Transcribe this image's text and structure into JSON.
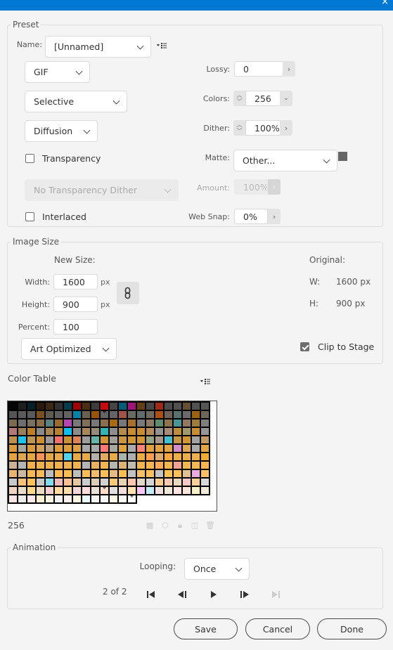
{
  "window": {
    "close_glyph": "×"
  },
  "preset": {
    "legend": "Preset",
    "name_label": "Name:",
    "name_value": "[Unnamed]",
    "format": "GIF",
    "palette": "Selective",
    "dither_method": "Diffusion",
    "transparency_label": "Transparency",
    "transparency_checked": false,
    "transparency_dither": "No Transparency Dither",
    "interlaced_label": "Interlaced",
    "interlaced_checked": false,
    "lossy_label": "Lossy:",
    "lossy_value": "0",
    "colors_label": "Colors:",
    "colors_value": "256",
    "dither_label": "Dither:",
    "dither_value": "100%",
    "matte_label": "Matte:",
    "matte_value": "Other...",
    "matte_color": "#666666",
    "amount_label": "Amount:",
    "amount_value": "100%",
    "websnap_label": "Web Snap:",
    "websnap_value": "0%"
  },
  "image_size": {
    "legend": "Image Size",
    "new_size_label": "New Size:",
    "width_label": "Width:",
    "width_value": "1600",
    "height_label": "Height:",
    "height_value": "900",
    "percent_label": "Percent:",
    "percent_value": "100",
    "unit": "px",
    "resample": "Art Optimized",
    "original_label": "Original:",
    "orig_w_label": "W:",
    "orig_w_value": "1600 px",
    "orig_h_label": "H:",
    "orig_h_value": "900 px",
    "clip_label": "Clip to Stage",
    "clip_checked": true
  },
  "color_table": {
    "title": "Color Table",
    "count": "256",
    "columns": 22,
    "selected_indices": [
      32,
      230,
      255
    ],
    "colors": [
      "#050505",
      "#1e1e1e",
      "#052028",
      "#2a1a0e",
      "#3c2814",
      "#303030",
      "#053c4a",
      "#a00505",
      "#4a2e14",
      "#3c3c3c",
      "#c80a0f",
      "#444444",
      "#055a78",
      "#a0147a",
      "#644019",
      "#464646",
      "#a02818",
      "#4a4a4a",
      "#505050",
      "#644e34",
      "#505050",
      "#555555",
      "#555555",
      "#5a5a5a",
      "#5a5a5a",
      "#7a5020",
      "#5e5a52",
      "#5e5e5e",
      "#626262",
      "#0a82a5",
      "#6a6050",
      "#965505",
      "#646464",
      "#646464",
      "#a05448",
      "#6a6a64",
      "#606c6a",
      "#6e6a60",
      "#aa5014",
      "#6e6258",
      "#5a706c",
      "#6a6a6a",
      "#9e620f",
      "#6e6658",
      "#7e6a50",
      "#6e6e6e",
      "#7a7060",
      "#8a6e48",
      "#5a8280",
      "#966a30",
      "#b446b4",
      "#787878",
      "#826e58",
      "#787878",
      "#8a6e50",
      "#aa6a14",
      "#787878",
      "#a87028",
      "#7a7a7a",
      "#8a7a64",
      "#5e8a6e",
      "#8e744c",
      "#489696",
      "#907862",
      "#a07c3a",
      "#808080",
      "#b47878",
      "#9a7e58",
      "#be7e28",
      "#8a8a8a",
      "#a88652",
      "#b48232",
      "#0abef0",
      "#8c8c8c",
      "#a8865a",
      "#968a78",
      "#32b4b4",
      "#8e8e8e",
      "#b48c50",
      "#c88c32",
      "#c88c32",
      "#b48c5a",
      "#929290",
      "#a88c78",
      "#be8c3c",
      "#a09a6a",
      "#c88c32",
      "#969696",
      "#be9050",
      "#1ec3ec",
      "#bc9456",
      "#cc9032",
      "#9a9a9a",
      "#f07070",
      "#cc9034",
      "#dc8456",
      "#9c9c9c",
      "#64b4a8",
      "#d29634",
      "#a0a098",
      "#c89646",
      "#d29634",
      "#d29634",
      "#96a482",
      "#a8968a",
      "#46bed2",
      "#c89648",
      "#d29634",
      "#a2a2a2",
      "#c09a64",
      "#d89a3c",
      "#a2a8a0",
      "#d89a3c",
      "#d2a05a",
      "#b8a082",
      "#dc9c3c",
      "#dc9e3c",
      "#dca046",
      "#a8a6a6",
      "#a8a8a8",
      "#ff7878",
      "#a8a8a0",
      "#e0a040",
      "#aaaaaa",
      "#ff8478",
      "#e0a23e",
      "#e2a240",
      "#e2a444",
      "#d28cc8",
      "#dca456",
      "#aaaaaa",
      "#e2a444",
      "#e6a440",
      "#dea650",
      "#e6a640",
      "#ff9256",
      "#e6a644",
      "#e6aa50",
      "#50d2f0",
      "#e8aa44",
      "#e8aa46",
      "#b4b0a8",
      "#e2aa60",
      "#eaac46",
      "#aab4aa",
      "#aeaeae",
      "#ecac44",
      "#ff9c50",
      "#dcaa6c",
      "#ffa440",
      "#ecae48",
      "#ecae48",
      "#eeb04a",
      "#f4aa32",
      "#cab096",
      "#b4b4b4",
      "#f0b04a",
      "#f0b24c",
      "#f0b24c",
      "#f2b24e",
      "#f2b24e",
      "#f2b44e",
      "#b4b4b4",
      "#e8b260",
      "#f2b450",
      "#b4b8b0",
      "#dcb478",
      "#c0bcb0",
      "#f2b650",
      "#f4b450",
      "#ffa858",
      "#f8b650",
      "#f4a094",
      "#f4b852",
      "#f6b854",
      "#f8b650",
      "#eab470",
      "#cab8a0",
      "#f6b854",
      "#f8ba56",
      "#bcbcbc",
      "#fcba50",
      "#fcbc52",
      "#bcc0b8",
      "#fabc56",
      "#f0bc6c",
      "#fcbe56",
      "#e6bc82",
      "#ffbe50",
      "#c2c2c2",
      "#f6c06a",
      "#fcc05a",
      "#c4c4c4",
      "#ffc058",
      "#ffc05a",
      "#e2c096",
      "#e6aade",
      "#ffbe6a",
      "#c8c8c8",
      "#f8c078",
      "#ffc25a",
      "#c8c8c8",
      "#82dcf0",
      "#ecbcbc",
      "#fac094",
      "#e6c8a0",
      "#cccccc",
      "#dcccb8",
      "#d2d2d2",
      "#ffc878",
      "#e8d2b4",
      "#ffc8ae",
      "#e0d8c8",
      "#d4d4d4",
      "#fccc8c",
      "#f8c8b4",
      "#e8d8c0",
      "#f8c8c8",
      "#ffd096",
      "#d8d8d8",
      "#f2d2c0",
      "#e6dcc8",
      "#ffd88c",
      "#eadcc4",
      "#f6d0d0",
      "#ffdca0",
      "#fcdcaa",
      "#f2d8d8",
      "#ffdcdc",
      "#e8e0d4",
      "#ffdcc8",
      "#e0e0e0",
      "#f2dcdc",
      "#ffe4b0",
      "#fcc8fc",
      "#c4ecf8",
      "#f2e0e0",
      "#f0e8d8",
      "#ffe2e2",
      "#ffe4dc",
      "#fff0c8",
      "#f0ead8",
      "#ffe6e6",
      "#ececec",
      "#ffe8ec",
      "#fff0d2",
      "#f8f2e2",
      "#f2f2f2",
      "#fff0f0",
      "#fff6e2",
      "#eaf8ff",
      "#f8f6f2",
      "#f6f6f6",
      "#fff8e6",
      "#fcfaf6",
      "#ffffff"
    ],
    "toolbar_icons": [
      "transparency-icon",
      "web-safe-cube-icon",
      "lock-icon",
      "new-color-icon",
      "delete-icon"
    ]
  },
  "animation": {
    "legend": "Animation",
    "looping_label": "Looping:",
    "looping_value": "Once",
    "frame_text": "2 of 2"
  },
  "buttons": {
    "save": "Save",
    "cancel": "Cancel",
    "done": "Done"
  }
}
